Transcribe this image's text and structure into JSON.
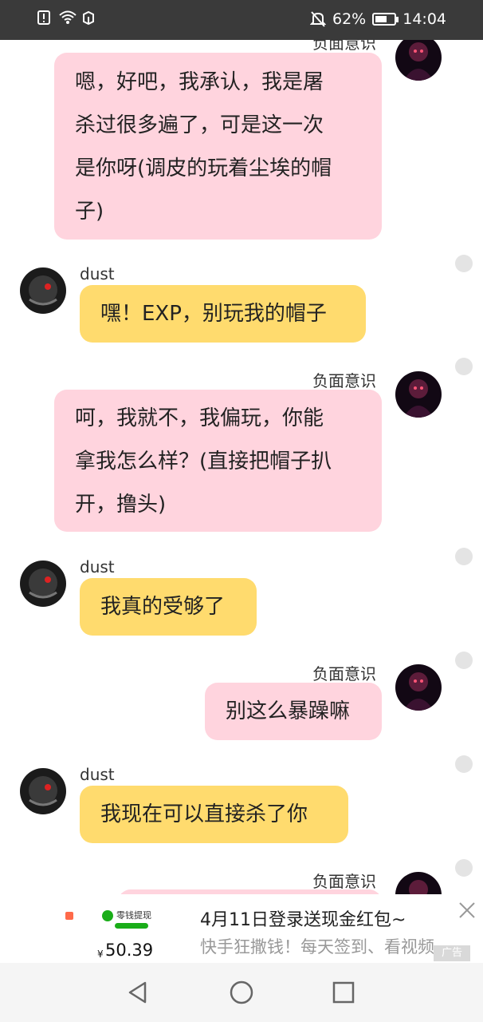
{
  "status_bar": {
    "battery_percent": "62%",
    "battery_level": 0.62,
    "time": "14:04",
    "left_icons": [
      "alert-icon",
      "wifi-icon",
      "app-notification-icon"
    ],
    "right_icons": [
      "mute-icon",
      "battery-icon"
    ]
  },
  "chat": {
    "messages": [
      {
        "sender": "负面意识",
        "side": "right",
        "text_lines": [
          "嗯，好吧，我承认，我是屠",
          "杀过很多遍了，可是这一次",
          "是你呀(调皮的玩着尘埃的帽",
          "子)"
        ]
      },
      {
        "sender": "dust",
        "side": "left",
        "text_lines": [
          "嘿！EXP，别玩我的帽子"
        ]
      },
      {
        "sender": "负面意识",
        "side": "right",
        "text_lines": [
          "呵，我就不，我偏玩，你能",
          "拿我怎么样？(直接把帽子扒",
          "开，撸头)"
        ]
      },
      {
        "sender": "dust",
        "side": "left",
        "text_lines": [
          "我真的受够了"
        ]
      },
      {
        "sender": "负面意识",
        "side": "right",
        "text_lines": [
          "别这么暴躁嘛"
        ]
      },
      {
        "sender": "dust",
        "side": "left",
        "text_lines": [
          "我现在可以直接杀了你"
        ]
      },
      {
        "sender": "负面意识",
        "side": "right",
        "text_lines": []
      }
    ]
  },
  "ad": {
    "thumb_label": "零钱提现",
    "thumb_currency": "¥",
    "thumb_amount": "50.39",
    "title": "4月11日登录送现金红包~",
    "description": "快手狂撒钱！每天签到、看视频",
    "tag": "广告",
    "close_icon": "close-icon"
  },
  "nav_bar": {
    "buttons": [
      "back-triangle-icon",
      "home-circle-icon",
      "recents-square-icon"
    ]
  },
  "colors": {
    "pink_bubble": "#ffd4de",
    "yellow_bubble": "#ffdb6e",
    "status_bar": "#3a3a3a"
  }
}
